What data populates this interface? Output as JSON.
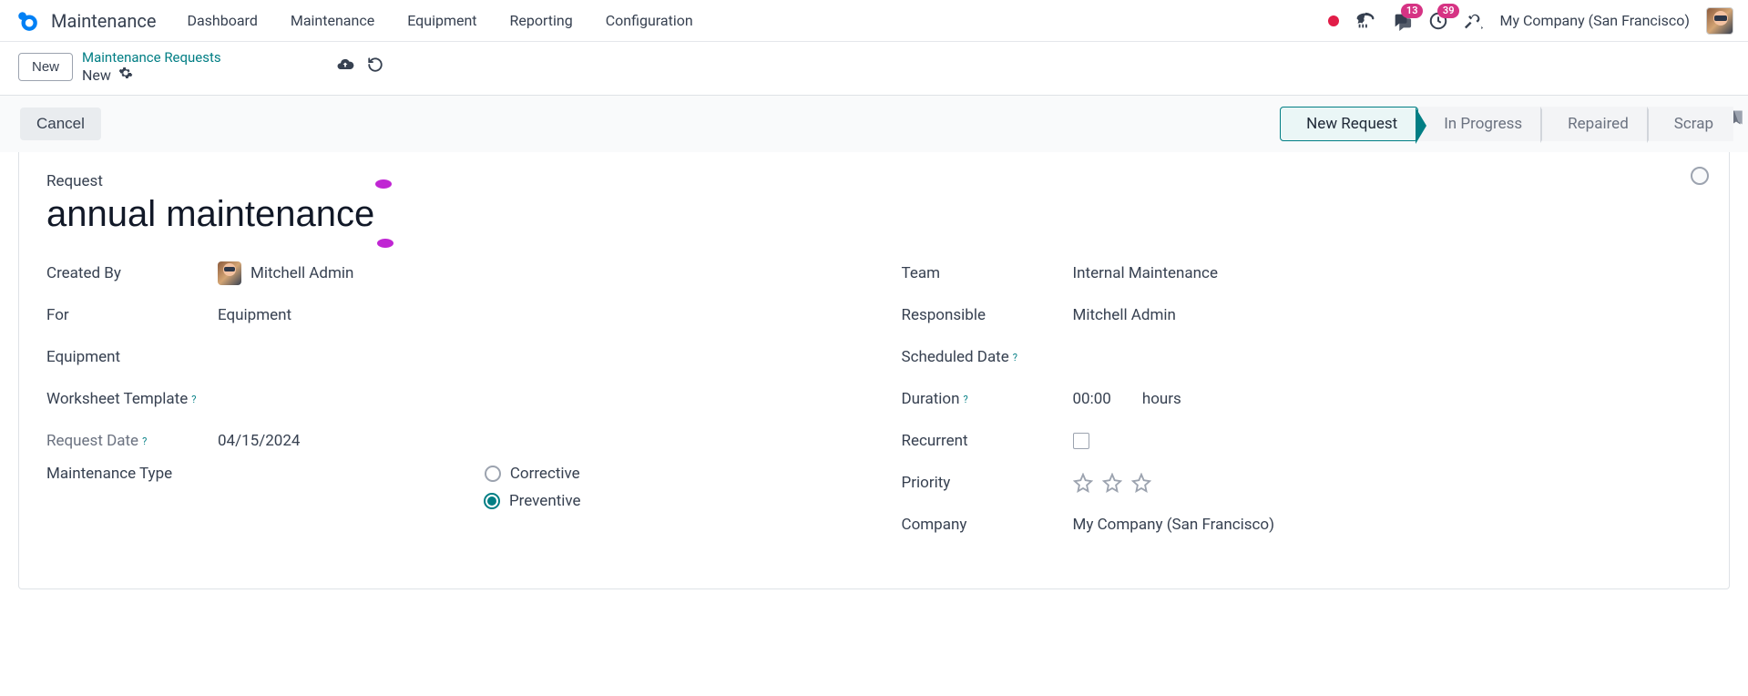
{
  "app": {
    "name": "Maintenance"
  },
  "nav": {
    "items": [
      "Dashboard",
      "Maintenance",
      "Equipment",
      "Reporting",
      "Configuration"
    ]
  },
  "header": {
    "messages_badge": "13",
    "activities_badge": "39",
    "company": "My Company (San Francisco)"
  },
  "actionbar": {
    "new_btn": "New",
    "breadcrumb_parent": "Maintenance Requests",
    "breadcrumb_current": "New"
  },
  "statusbar": {
    "cancel": "Cancel",
    "steps": [
      "New Request",
      "In Progress",
      "Repaired",
      "Scrap"
    ],
    "active_index": 0
  },
  "form": {
    "request_label": "Request",
    "title": "annual maintenance",
    "left": {
      "created_by": {
        "label": "Created By",
        "value": "Mitchell Admin"
      },
      "for": {
        "label": "For",
        "value": "Equipment"
      },
      "equipment": {
        "label": "Equipment",
        "value": ""
      },
      "worksheet_template": {
        "label": "Worksheet Template",
        "value": ""
      },
      "request_date": {
        "label": "Request Date",
        "value": "04/15/2024"
      },
      "maintenance_type": {
        "label": "Maintenance Type",
        "options": {
          "corrective": "Corrective",
          "preventive": "Preventive"
        },
        "selected": "preventive"
      }
    },
    "right": {
      "team": {
        "label": "Team",
        "value": "Internal Maintenance"
      },
      "responsible": {
        "label": "Responsible",
        "value": "Mitchell Admin"
      },
      "scheduled_date": {
        "label": "Scheduled Date",
        "value": ""
      },
      "duration": {
        "label": "Duration",
        "value": "00:00",
        "unit": "hours"
      },
      "recurrent": {
        "label": "Recurrent",
        "checked": false
      },
      "priority": {
        "label": "Priority"
      },
      "company": {
        "label": "Company",
        "value": "My Company (San Francisco)"
      }
    }
  }
}
